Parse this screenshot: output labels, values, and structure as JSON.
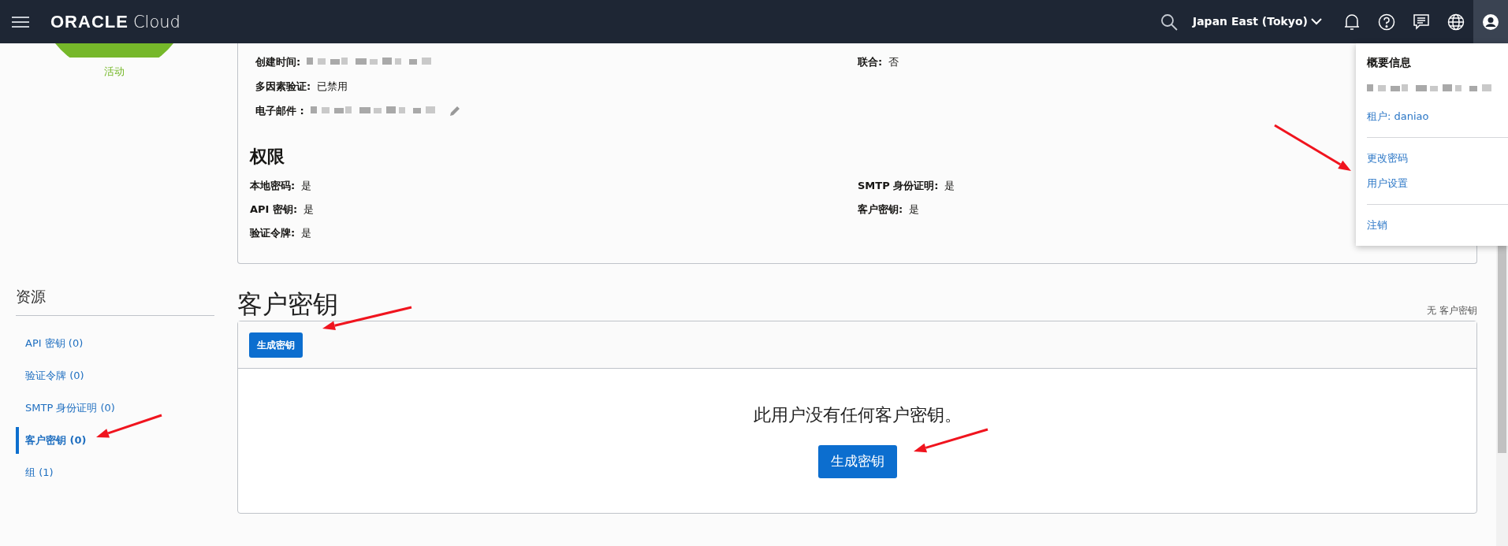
{
  "top_bar": {
    "brand": {
      "wordmark": "ORACLE",
      "product": "Cloud"
    },
    "region": "Japan East (Tokyo)"
  },
  "user_menu": {
    "title": "概要信息",
    "tenant": "租户: daniao",
    "groups": [
      {
        "items": [
          "更改密码",
          "用户设置"
        ]
      },
      {
        "items": [
          "注销"
        ]
      }
    ]
  },
  "user_status": {
    "label": "活动"
  },
  "user_details": {
    "left": [
      {
        "label": "创建时间:",
        "kind": "redacted"
      },
      {
        "label": "多因素验证:",
        "kind": "text",
        "value": "已禁用"
      },
      {
        "label": "电子邮件 :",
        "kind": "redacted",
        "editable": true
      }
    ],
    "right": [
      {
        "label": "联合:",
        "kind": "text",
        "value": "否"
      }
    ]
  },
  "permissions": {
    "title": "权限",
    "left": [
      {
        "label": "本地密码:",
        "value": "是"
      },
      {
        "label": "API 密钥:",
        "value": "是"
      },
      {
        "label": "验证令牌:",
        "value": "是"
      }
    ],
    "right": [
      {
        "label": "SMTP 身份证明:",
        "value": "是"
      },
      {
        "label": "客户密钥:",
        "value": "是"
      }
    ]
  },
  "resources": {
    "title": "资源",
    "items": [
      {
        "label": "API 密钥 (0)",
        "selected": false
      },
      {
        "label": "验证令牌 (0)",
        "selected": false
      },
      {
        "label": "SMTP 身份证明 (0)",
        "selected": false
      },
      {
        "label": "客户密钥 (0)",
        "selected": true
      },
      {
        "label": "组 (1)",
        "selected": false
      }
    ]
  },
  "customer_keys": {
    "title": "客户密钥",
    "count_note": "无 客户密钥",
    "toolbar_button": "生成密钥",
    "empty_message": "此用户没有任何客户密钥。",
    "empty_button": "生成密钥"
  }
}
